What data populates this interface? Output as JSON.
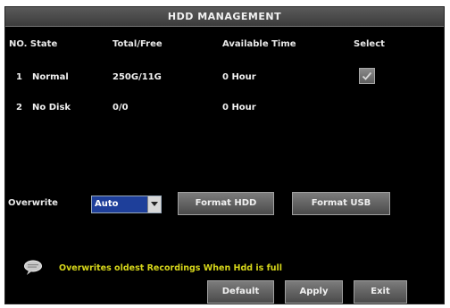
{
  "window": {
    "title": "HDD MANAGEMENT"
  },
  "table": {
    "headers": {
      "no_state": "NO. State",
      "total_free": "Total/Free",
      "available_time": "Available Time",
      "select": "Select"
    },
    "rows": [
      {
        "no": "1",
        "state": "Normal",
        "total_free": "250G/11G",
        "available_time": "0 Hour",
        "selected": true
      },
      {
        "no": "2",
        "state": "No Disk",
        "total_free": "0/0",
        "available_time": "0 Hour",
        "selected": false
      }
    ]
  },
  "overwrite": {
    "label": "Overwrite",
    "value": "Auto"
  },
  "buttons": {
    "format_hdd": "Format HDD",
    "format_usb": "Format USB",
    "default": "Default",
    "apply": "Apply",
    "exit": "Exit"
  },
  "info": {
    "icon": "info-bubble-icon",
    "text": "Overwrites oldest Recordings When Hdd is full"
  },
  "colors": {
    "title_bar": "#4a4a4a",
    "select_bg": "#1e3f9a",
    "info_text": "#d6d61a"
  }
}
